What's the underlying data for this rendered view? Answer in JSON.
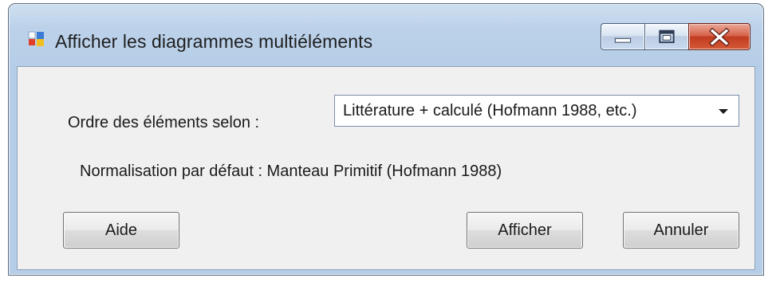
{
  "window": {
    "title": "Afficher les diagrammes multiéléments",
    "controls": {
      "minimize": "minimize-icon",
      "maximize": "maximize-icon",
      "close": "close-icon"
    }
  },
  "form": {
    "order_label": "Ordre des éléments selon :",
    "order_selected": "Littérature + calculé (Hofmann 1988, etc.)",
    "normalisation_text": "Normalisation par défaut : Manteau Primitif (Hofmann 1988)"
  },
  "buttons": {
    "help": "Aide",
    "show": "Afficher",
    "cancel": "Annuler"
  },
  "colors": {
    "title_bar": "#bcd2ea",
    "close_button": "#c13b20",
    "dialog_body": "#f0f0f0"
  }
}
